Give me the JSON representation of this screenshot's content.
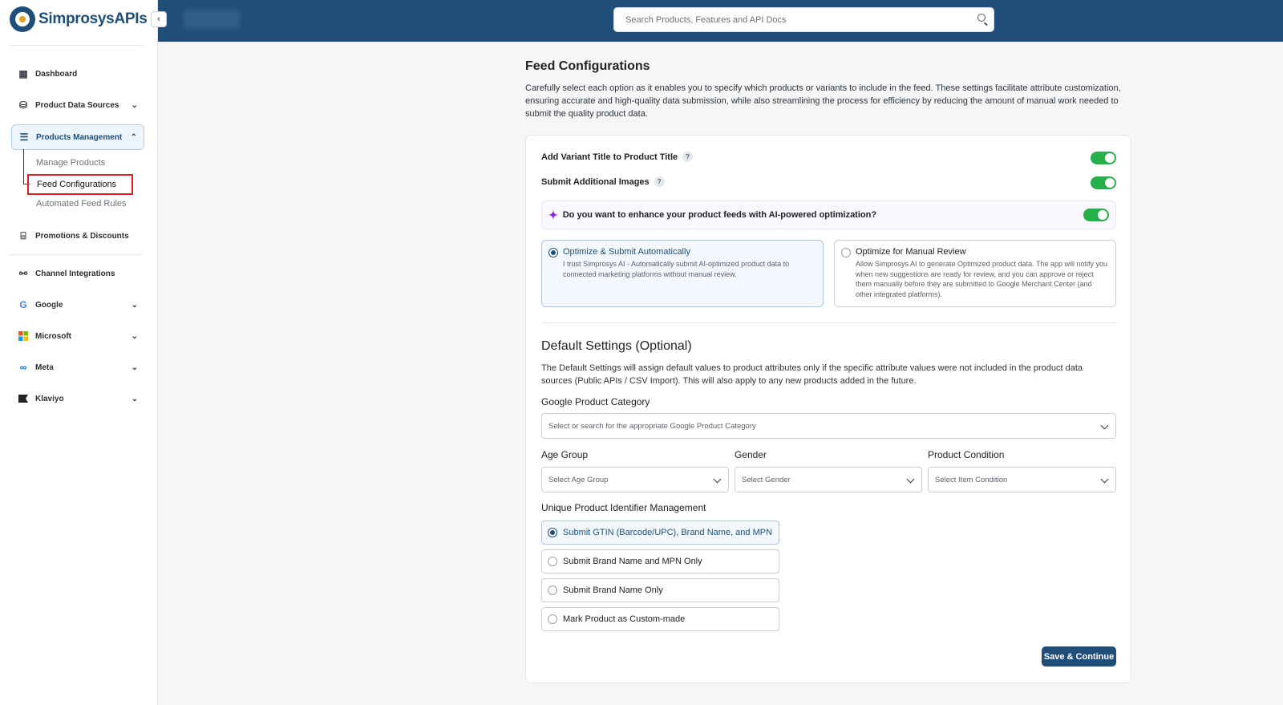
{
  "app": {
    "name": "SimprosysAPIs"
  },
  "topbar": {
    "search_placeholder": "Search Products, Features and API Docs"
  },
  "sidebar": {
    "items": [
      {
        "label": "Dashboard",
        "icon": "grid-icon"
      },
      {
        "label": "Product Data Sources",
        "icon": "data-source-icon"
      },
      {
        "label": "Products Management",
        "icon": "list-icon"
      },
      {
        "label": "Promotions & Discounts",
        "icon": "ticket-icon"
      },
      {
        "label": "Channel Integrations",
        "icon": "integration-icon"
      },
      {
        "label": "Google",
        "icon": "google-icon"
      },
      {
        "label": "Microsoft",
        "icon": "microsoft-icon"
      },
      {
        "label": "Meta",
        "icon": "meta-icon"
      },
      {
        "label": "Klaviyo",
        "icon": "klaviyo-icon"
      }
    ],
    "sub_items": [
      {
        "label": "Manage Products"
      },
      {
        "label": "Feed Configurations"
      },
      {
        "label": "Automated Feed Rules"
      }
    ]
  },
  "main": {
    "title": "Feed Configurations",
    "description": "Carefully select each option as it enables you to specify which products or variants to include in the feed. These settings facilitate attribute customization, ensuring accurate and high-quality data submission, while also streamlining the process for efficiency by reducing the amount of manual work needed to submit the quality product data.",
    "toggles": [
      {
        "label": "Add Variant Title to Product Title",
        "on": true
      },
      {
        "label": "Submit Additional Images",
        "on": true
      }
    ],
    "ai": {
      "question": "Do you want to enhance your product feeds with AI-powered optimization?",
      "on": true,
      "options": [
        {
          "title": "Optimize & Submit Automatically",
          "desc": "I trust Simprosys AI - Automatically submit AI-optimized product data to connected marketing platforms without manual review.",
          "selected": true
        },
        {
          "title": "Optimize for Manual Review",
          "desc": "Allow Simprosys AI to generate Optimized product data. The app will notify you when new suggestions are ready for review, and you can approve or reject them manually before they are submitted to Google Merchant Center (and other integrated platforms).",
          "selected": false
        }
      ]
    },
    "default_settings": {
      "title": "Default Settings (Optional)",
      "description": "The Default Settings will assign default values to product attributes only if the specific attribute values were not included in the product data sources (Public APIs / CSV Import). This will also apply to any new products added in the future.",
      "google_category": {
        "label": "Google Product Category",
        "placeholder": "Select or search for the appropriate Google Product Category"
      },
      "age_group": {
        "label": "Age Group",
        "placeholder": "Select Age Group"
      },
      "gender": {
        "label": "Gender",
        "placeholder": "Select Gender"
      },
      "condition": {
        "label": "Product Condition",
        "placeholder": "Select Item Condition"
      },
      "identifier": {
        "label": "Unique Product Identifier Management",
        "options": [
          {
            "label": "Submit GTIN (Barcode/UPC), Brand Name, and MPN",
            "selected": true
          },
          {
            "label": "Submit Brand Name and MPN Only",
            "selected": false
          },
          {
            "label": "Submit Brand Name Only",
            "selected": false
          },
          {
            "label": "Mark Product as Custom-made",
            "selected": false
          }
        ]
      }
    },
    "save_label": "Save & Continue"
  },
  "colors": {
    "brand": "#1f4e79",
    "toggle_on": "#25b04a",
    "highlight": "#e31b23"
  }
}
